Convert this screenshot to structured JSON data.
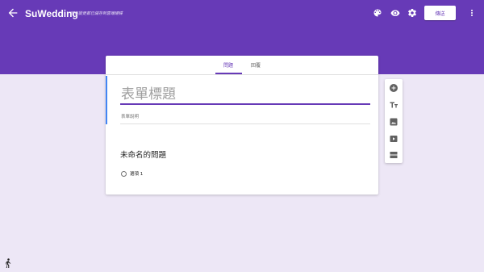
{
  "header": {
    "title": "SuWedding",
    "save_status": "所有變更都已儲存到雲端硬碟",
    "send_label": "傳送",
    "accent": "#673ab7"
  },
  "tabs": [
    {
      "label": "問題",
      "active": true
    },
    {
      "label": "回覆",
      "active": false
    }
  ],
  "form": {
    "title": "表單標題",
    "description": "表單說明"
  },
  "question": {
    "title": "未命名的問題",
    "options": [
      "選項 1"
    ]
  },
  "toolbar": {
    "icons": [
      "add-question-icon",
      "add-title-icon",
      "add-image-icon",
      "add-video-icon",
      "add-section-icon"
    ]
  },
  "icons": [
    "back-arrow-icon",
    "palette-icon",
    "preview-eye-icon",
    "settings-gear-icon",
    "more-vert-icon",
    "walking-person-icon"
  ]
}
